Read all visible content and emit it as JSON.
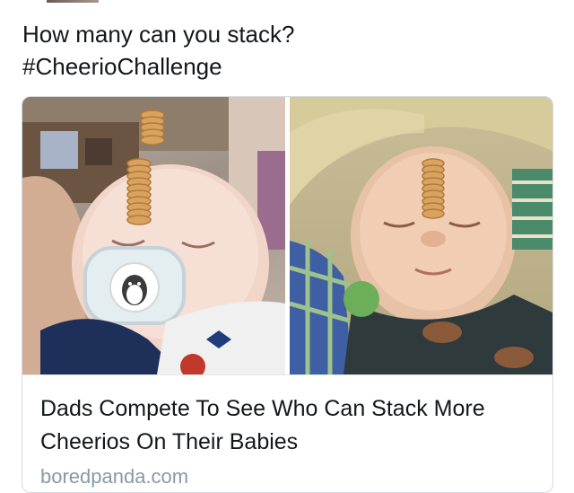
{
  "tweet": {
    "text_line1": "How many can you stack?",
    "text_line2": "#CheerioChallenge"
  },
  "card": {
    "title": "Dads Compete To See Who Can Stack More Cheerios On Their Babies",
    "domain": "boredpanda.com"
  },
  "colors": {
    "text": "#14171a",
    "secondary_text": "#8899a6",
    "card_border": "#d5dbe0"
  }
}
